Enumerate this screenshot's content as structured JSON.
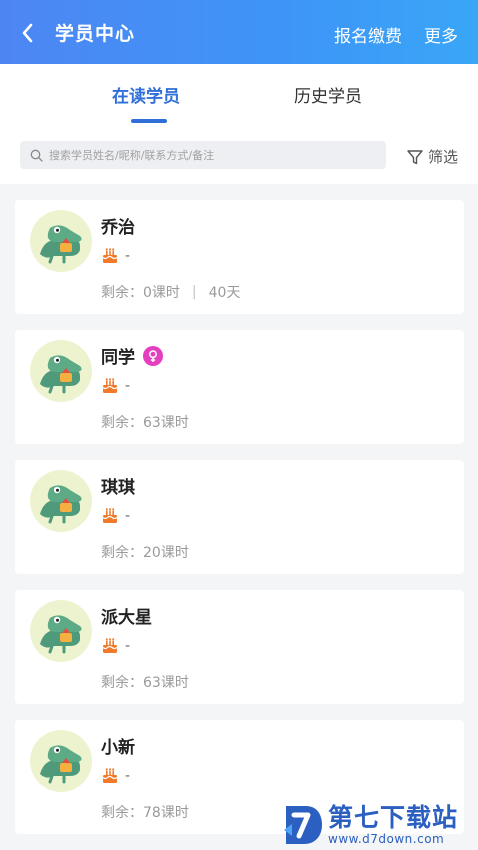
{
  "header": {
    "title": "学员中心",
    "actions": [
      "报名缴费",
      "更多"
    ]
  },
  "tabs": [
    {
      "label": "在读学员",
      "active": true
    },
    {
      "label": "历史学员",
      "active": false
    }
  ],
  "search": {
    "placeholder": "搜索学员姓名/昵称/联系方式/备注",
    "filter_label": "筛选"
  },
  "students": [
    {
      "name": "乔治",
      "birthday": "-",
      "remain_label": "剩余：",
      "remain": "0课时",
      "days": "40天",
      "gender": null
    },
    {
      "name": "同学",
      "birthday": "-",
      "remain_label": "剩余：",
      "remain": "63课时",
      "days": null,
      "gender": "female-symbol"
    },
    {
      "name": "琪琪",
      "birthday": "-",
      "remain_label": "剩余：",
      "remain": "20课时",
      "days": null,
      "gender": null
    },
    {
      "name": "派大星",
      "birthday": "-",
      "remain_label": "剩余：",
      "remain": "63课时",
      "days": null,
      "gender": null
    },
    {
      "name": "小新",
      "birthday": "-",
      "remain_label": "剩余：",
      "remain": "78课时",
      "days": null,
      "gender": null
    }
  ],
  "watermark": {
    "brand": "第七下载站",
    "url": "www.d7down.com"
  },
  "colors": {
    "accent": "#2e6fd8",
    "header_start": "#4d86f3",
    "header_end": "#39a6f7",
    "gender_badge": "#e43fbf",
    "cake": "#f07a2a"
  }
}
